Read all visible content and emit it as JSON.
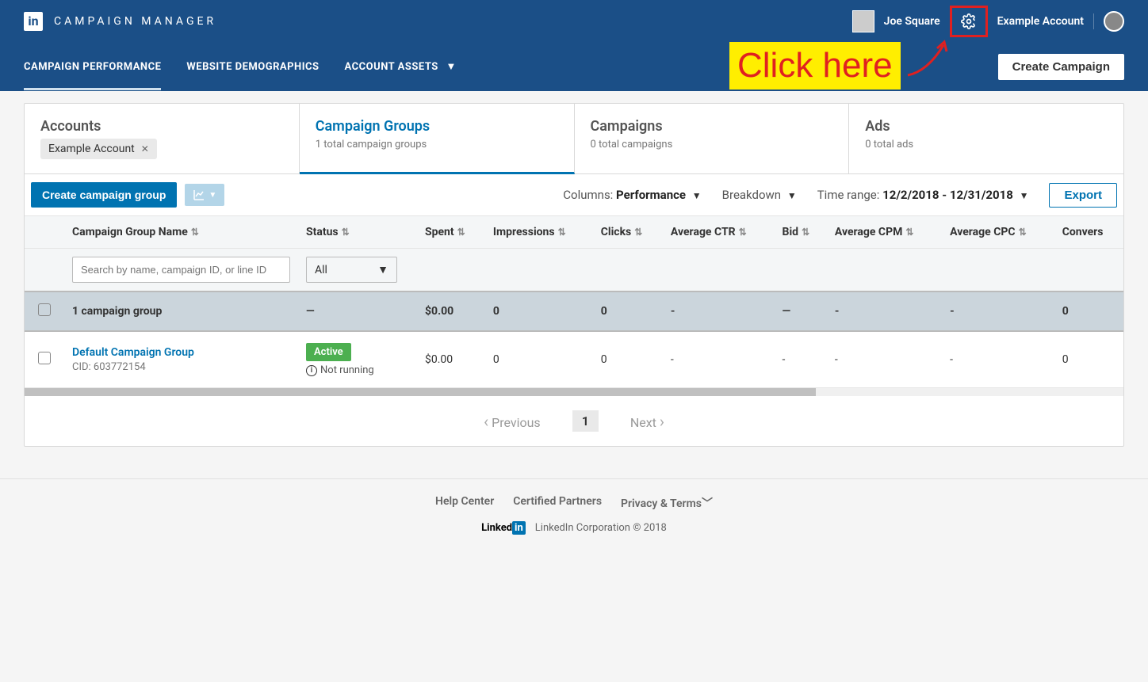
{
  "header": {
    "app_title": "CAMPAIGN MANAGER",
    "user_name": "Joe Square",
    "account_name": "Example Account"
  },
  "annotation": {
    "text": "Click here"
  },
  "subnav": {
    "tab1": "CAMPAIGN PERFORMANCE",
    "tab2": "WEBSITE DEMOGRAPHICS",
    "tab3": "ACCOUNT ASSETS",
    "create_btn": "Create Campaign"
  },
  "tabs": {
    "accounts": {
      "title": "Accounts",
      "chip": "Example Account"
    },
    "groups": {
      "title": "Campaign Groups",
      "sub": "1 total campaign groups"
    },
    "campaigns": {
      "title": "Campaigns",
      "sub": "0 total campaigns"
    },
    "ads": {
      "title": "Ads",
      "sub": "0 total ads"
    }
  },
  "toolbar": {
    "create_group": "Create campaign group",
    "columns_label": "Columns:",
    "columns_value": "Performance",
    "breakdown": "Breakdown",
    "time_label": "Time range:",
    "time_value": "12/2/2018 - 12/31/2018",
    "export": "Export"
  },
  "columns": {
    "name": "Campaign Group Name",
    "status": "Status",
    "spent": "Spent",
    "impressions": "Impressions",
    "clicks": "Clicks",
    "ctr": "Average CTR",
    "bid": "Bid",
    "cpm": "Average CPM",
    "cpc": "Average CPC",
    "conv": "Convers"
  },
  "filters": {
    "search_placeholder": "Search by name, campaign ID, or line ID",
    "status_all": "All"
  },
  "summary": {
    "label": "1 campaign group",
    "spent": "$0.00",
    "impressions": "0",
    "clicks": "0",
    "ctr": "-",
    "bid": "—",
    "cpm": "-",
    "cpc": "-",
    "conv": "0"
  },
  "row": {
    "name": "Default Campaign Group",
    "cid": "CID: 603772154",
    "status": "Active",
    "status_note": "Not running",
    "spent": "$0.00",
    "impressions": "0",
    "clicks": "0",
    "ctr": "-",
    "bid": "-",
    "cpm": "-",
    "cpc": "-",
    "conv": "0"
  },
  "pagination": {
    "prev": "Previous",
    "page": "1",
    "next": "Next"
  },
  "footer": {
    "help": "Help Center",
    "partners": "Certified Partners",
    "privacy": "Privacy & Terms",
    "corp": "LinkedIn Corporation © 2018"
  }
}
